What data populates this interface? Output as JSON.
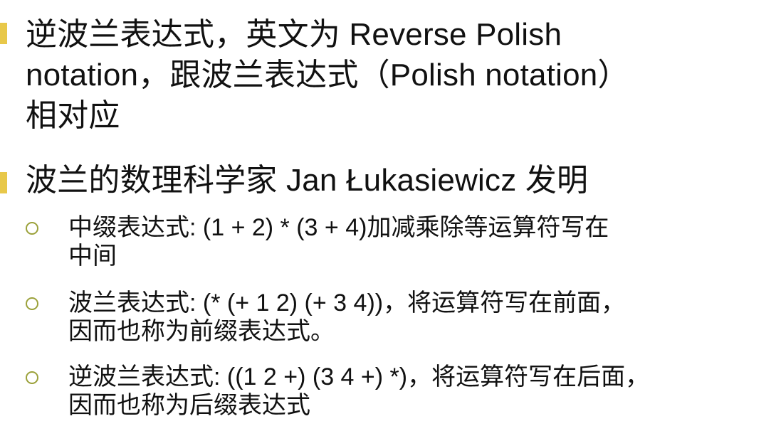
{
  "slide": {
    "bullets": [
      {
        "level": 1,
        "lines": [
          "逆波兰表达式，英文为 Reverse Polish",
          "notation，跟波兰表达式（Polish notation）",
          "相对应"
        ]
      },
      {
        "level": 1,
        "lines": [
          "波兰的数理科学家 Jan Łukasiewicz 发明"
        ]
      },
      {
        "level": 2,
        "lines": [
          "中缀表达式:  (1 + 2) * (3 + 4)加减乘除等运算符写在",
          "中间"
        ]
      },
      {
        "level": 2,
        "lines": [
          "波兰表达式:  (* (+ 1 2) (+ 3 4))，将运算符写在前面，",
          "因而也称为前缀表达式。"
        ]
      },
      {
        "level": 2,
        "lines": [
          "逆波兰表达式: ((1 2 +) (3 4 +) *)，将运算符写在后面，",
          "因而也称为后缀表达式"
        ]
      }
    ],
    "colors": {
      "level1_bullet": "#E8C84A",
      "level2_bullet": "#9BA13A",
      "text": "#111111"
    }
  }
}
